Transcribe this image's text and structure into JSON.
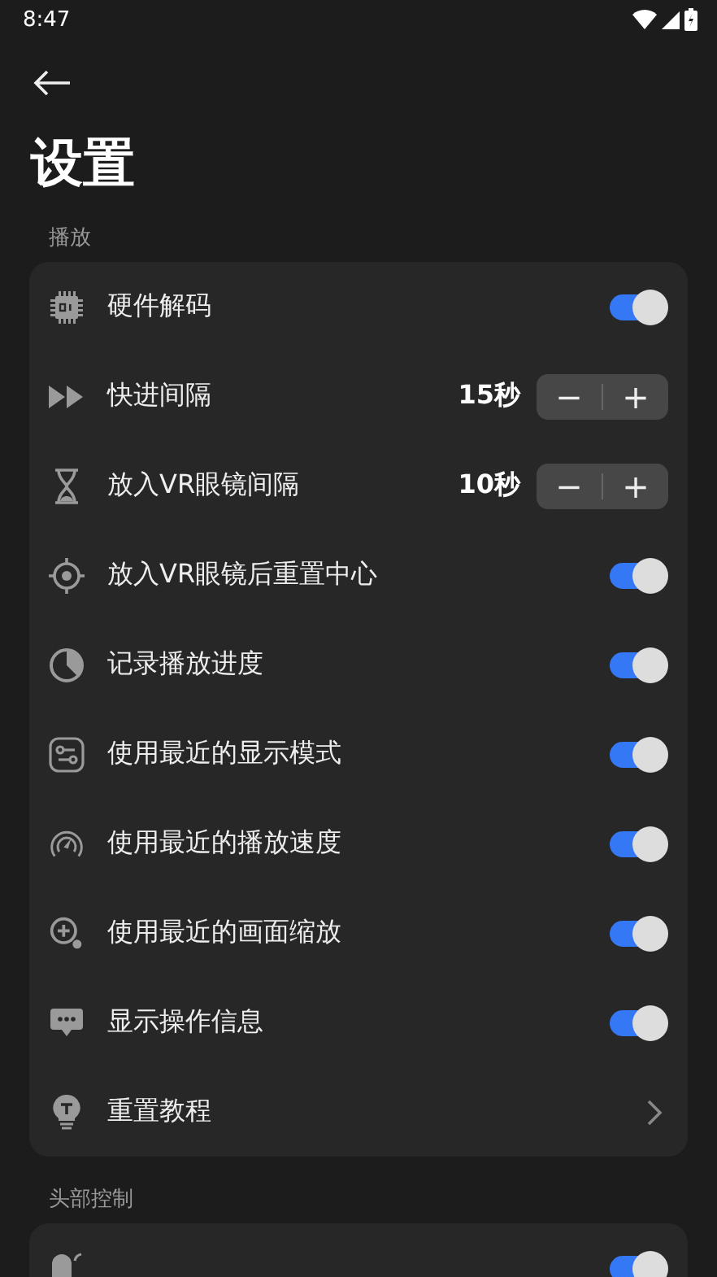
{
  "status_bar": {
    "time": "8:47"
  },
  "title": "设置",
  "sections": [
    {
      "header": "播放",
      "items": [
        {
          "kind": "toggle",
          "label": "硬件解码",
          "on": true
        },
        {
          "kind": "stepper",
          "label": "快进间隔",
          "value": "15秒",
          "minus": "−",
          "plus": "+"
        },
        {
          "kind": "stepper",
          "label": "放入VR眼镜间隔",
          "value": "10秒",
          "minus": "−",
          "plus": "+"
        },
        {
          "kind": "toggle",
          "label": "放入VR眼镜后重置中心",
          "on": true
        },
        {
          "kind": "toggle",
          "label": "记录播放进度",
          "on": true
        },
        {
          "kind": "toggle",
          "label": "使用最近的显示模式",
          "on": true
        },
        {
          "kind": "toggle",
          "label": "使用最近的播放速度",
          "on": true
        },
        {
          "kind": "toggle",
          "label": "使用最近的画面缩放",
          "on": true
        },
        {
          "kind": "toggle",
          "label": "显示操作信息",
          "on": true
        },
        {
          "kind": "link",
          "label": "重置教程"
        }
      ]
    },
    {
      "header": "头部控制",
      "items": [
        {
          "kind": "toggle",
          "on": true
        }
      ]
    }
  ]
}
